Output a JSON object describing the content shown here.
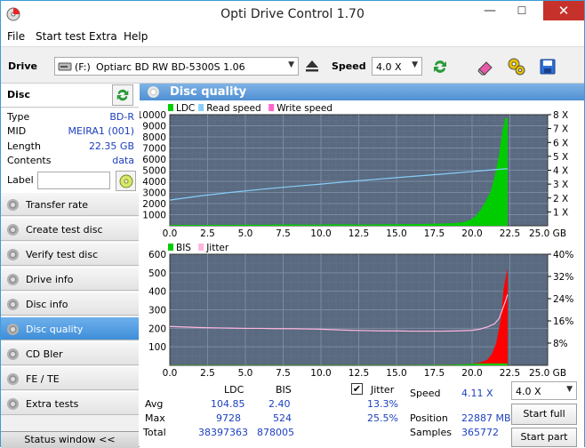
{
  "window": {
    "title": "Opti Drive Control 1.70",
    "minimize": "—",
    "maximize": "☐",
    "close": "✕"
  },
  "menu": {
    "file": "File",
    "start_test": "Start test",
    "extra": "Extra",
    "help": "Help"
  },
  "toolbar": {
    "drive_label": "Drive",
    "drive_letter": "(F:)",
    "drive_name": "Optiarc BD RW BD-5300S 1.06",
    "speed_label": "Speed",
    "speed_value": "4.0 X"
  },
  "disc": {
    "header": "Disc",
    "type_label": "Type",
    "type_value": "BD-R",
    "mid_label": "MID",
    "mid_value": "MEIRA1 (001)",
    "length_label": "Length",
    "length_value": "22.35 GB",
    "contents_label": "Contents",
    "contents_value": "data",
    "label_label": "Label",
    "label_value": ""
  },
  "nav": [
    {
      "label": "Transfer rate"
    },
    {
      "label": "Create test disc"
    },
    {
      "label": "Verify test disc"
    },
    {
      "label": "Drive info"
    },
    {
      "label": "Disc info"
    },
    {
      "label": "Disc quality"
    },
    {
      "label": "CD Bler"
    },
    {
      "label": "FE / TE"
    },
    {
      "label": "Extra tests"
    }
  ],
  "status_window": "Status window <<",
  "panel": {
    "title": "Disc quality"
  },
  "chart_data": [
    {
      "type": "area",
      "legend": [
        "LDC",
        "Read speed",
        "Write speed"
      ],
      "colors": {
        "LDC": "#00cc00",
        "Read speed": "#87cefa",
        "Write speed": "#ff66cc",
        "background": "#5a6a80",
        "grid": "#7a8aa0"
      },
      "xlim": [
        0,
        25
      ],
      "ylim": [
        0,
        10000
      ],
      "x_ticks": [
        "0.0",
        "2.5",
        "5.0",
        "7.5",
        "10.0",
        "12.5",
        "15.0",
        "17.5",
        "20.0",
        "22.5",
        "25.0 GB"
      ],
      "y_ticks": [
        "10000",
        "9000",
        "8000",
        "7000",
        "6000",
        "5000",
        "4000",
        "3000",
        "2000",
        "1000"
      ],
      "y2_ticks": [
        "8 X",
        "7 X",
        "6 X",
        "5 X",
        "4 X",
        "3 X",
        "2 X",
        "1 X"
      ],
      "y2lim": [
        0,
        8
      ],
      "ldc": {
        "x": [
          0,
          1,
          2,
          3,
          4,
          5,
          6,
          7,
          8,
          9,
          10,
          11,
          12,
          13,
          14,
          15,
          16,
          17,
          18,
          19,
          19.5,
          20,
          20.3,
          20.6,
          20.9,
          21.2,
          21.5,
          21.8,
          22.0,
          22.2,
          22.35
        ],
        "y": [
          60,
          80,
          70,
          90,
          80,
          100,
          90,
          110,
          120,
          100,
          110,
          130,
          120,
          110,
          130,
          140,
          150,
          170,
          200,
          260,
          350,
          600,
          1000,
          1500,
          2200,
          3000,
          4500,
          6500,
          8500,
          9728,
          9700
        ]
      },
      "read_speed": {
        "x": [
          0,
          2,
          4,
          6,
          8,
          10,
          12,
          14,
          16,
          18,
          20,
          21,
          22.35
        ],
        "y": [
          1.85,
          2.15,
          2.4,
          2.62,
          2.82,
          3.0,
          3.2,
          3.38,
          3.55,
          3.72,
          3.9,
          4.0,
          4.11
        ]
      }
    },
    {
      "type": "area",
      "legend": [
        "BIS",
        "Jitter"
      ],
      "colors": {
        "BIS": "#00cc00",
        "BIS_high": "#ff0000",
        "Jitter": "#ffb6e0",
        "background": "#5a6a80",
        "grid": "#7a8aa0"
      },
      "xlim": [
        0,
        25
      ],
      "ylim": [
        0,
        600
      ],
      "x_ticks": [
        "0.0",
        "2.5",
        "5.0",
        "7.5",
        "10.0",
        "12.5",
        "15.0",
        "17.5",
        "20.0",
        "22.5",
        "25.0 GB"
      ],
      "y_ticks": [
        "600",
        "500",
        "400",
        "300",
        "200",
        "100"
      ],
      "y2_ticks": [
        "40%",
        "32%",
        "24%",
        "16%",
        "8%"
      ],
      "y2lim": [
        0,
        40
      ],
      "bis": {
        "x": [
          0,
          2,
          4,
          6,
          8,
          10,
          12,
          14,
          16,
          18,
          19,
          20,
          20.5,
          21,
          21.3,
          21.6,
          21.9,
          22.1,
          22.35
        ],
        "y": [
          2,
          2,
          2,
          2,
          2,
          2,
          2,
          2,
          2,
          3,
          4,
          8,
          15,
          30,
          60,
          120,
          250,
          420,
          524
        ]
      },
      "jitter": {
        "x": [
          0,
          1,
          2,
          3,
          4,
          5,
          6,
          7,
          8,
          9,
          10,
          11,
          12,
          13,
          14,
          15,
          16,
          17,
          18,
          19,
          20,
          20.5,
          21,
          21.5,
          21.8,
          22.0,
          22.2,
          22.35
        ],
        "y": [
          14.0,
          13.8,
          13.6,
          13.5,
          13.4,
          13.3,
          13.3,
          13.2,
          13.2,
          13.1,
          13.0,
          12.8,
          12.6,
          12.5,
          12.4,
          12.4,
          12.3,
          12.3,
          12.3,
          12.4,
          12.6,
          13.0,
          13.8,
          15.0,
          17.0,
          20.0,
          23.0,
          25.5
        ]
      }
    }
  ],
  "stats": {
    "col_ldc": "LDC",
    "col_bis": "BIS",
    "avg_label": "Avg",
    "avg_ldc": "104.85",
    "avg_bis": "2.40",
    "max_label": "Max",
    "max_ldc": "9728",
    "max_bis": "524",
    "total_label": "Total",
    "total_ldc": "38397363",
    "total_bis": "878005",
    "jitter_label": "Jitter",
    "jitter_checked": "✔",
    "jitter_avg": "13.3%",
    "jitter_max": "25.5%",
    "speed_label": "Speed",
    "speed_value": "4.11 X",
    "speed_select": "4.0 X",
    "position_label": "Position",
    "position_value": "22887 MB",
    "samples_label": "Samples",
    "samples_value": "365772",
    "start_full": "Start full",
    "start_part": "Start part"
  }
}
